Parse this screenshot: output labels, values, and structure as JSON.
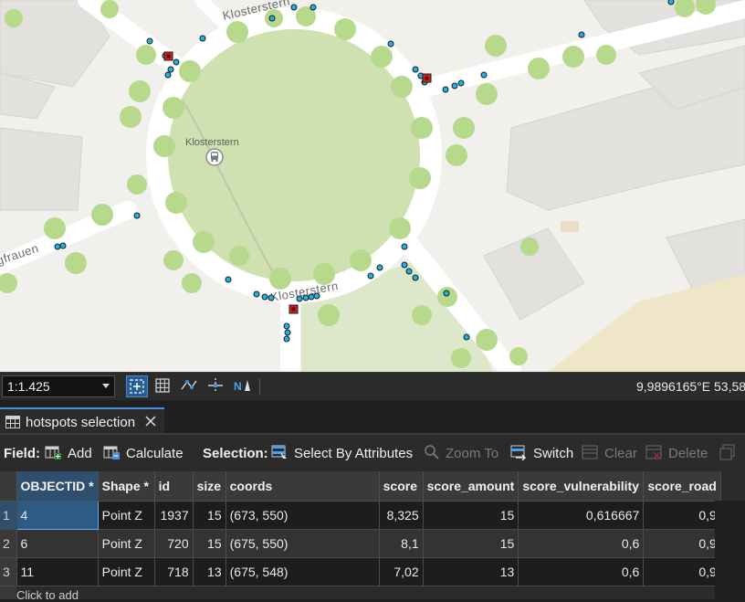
{
  "map": {
    "street_labels": [
      "Klosterstern",
      "Klosterstern",
      "gfrauen"
    ],
    "place_label": "Klosterstern",
    "transit_icon": "bus-stop-icon"
  },
  "statusbar": {
    "scale": "1:1.425",
    "coordinates": "9,9896165°E 53,58",
    "icons": [
      "extent-icon",
      "grid-icon",
      "snapping-icon",
      "constraint-icon",
      "north-arrow-icon"
    ]
  },
  "tab": {
    "title": "hotspots selection",
    "icon": "table-icon"
  },
  "toolbar": {
    "field_label": "Field:",
    "add": "Add",
    "calculate": "Calculate",
    "selection_label": "Selection:",
    "select_by_attributes": "Select By Attributes",
    "zoom_to": "Zoom To",
    "switch": "Switch",
    "clear": "Clear",
    "delete": "Delete"
  },
  "table": {
    "columns": [
      "OBJECTID *",
      "Shape *",
      "id",
      "size",
      "coords",
      "score",
      "score_amount",
      "score_vulnerability",
      "score_road"
    ],
    "rows": [
      {
        "rownum": "1",
        "objectid": "4",
        "shape": "Point Z",
        "id": "1937",
        "size": "15",
        "coords": "(673, 550)",
        "score": "8,325",
        "score_amount": "15",
        "score_vulnerability": "0,616667",
        "score_road": "0,9"
      },
      {
        "rownum": "2",
        "objectid": "6",
        "shape": "Point Z",
        "id": "720",
        "size": "15",
        "coords": "(675, 550)",
        "score": "8,1",
        "score_amount": "15",
        "score_vulnerability": "0,6",
        "score_road": "0,9"
      },
      {
        "rownum": "3",
        "objectid": "11",
        "shape": "Point Z",
        "id": "718",
        "size": "13",
        "coords": "(675, 548)",
        "score": "7,02",
        "score_amount": "13",
        "score_vulnerability": "0,6",
        "score_road": "0,9"
      }
    ],
    "footer": "Click to add"
  },
  "colors": {
    "accent": "#4a90d9",
    "point_fill": "#1fb2e6",
    "hotspot_fill": "#d42020",
    "park": "#cfe1b1",
    "tree": "#b6d98c"
  }
}
